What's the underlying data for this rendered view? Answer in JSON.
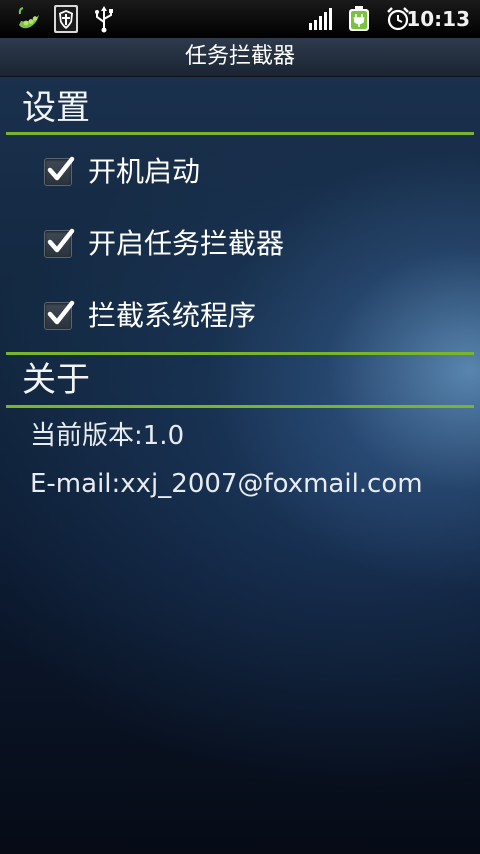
{
  "status_bar": {
    "time": "10:13",
    "icons": [
      "pea-pod-icon",
      "shield-app-icon",
      "usb-icon",
      "signal-icon",
      "battery-charging-icon",
      "alarm-clock-icon"
    ]
  },
  "app": {
    "title": "任务拦截器"
  },
  "settings_section": {
    "title": "设置",
    "items": [
      {
        "label": "开机启动",
        "checked": true
      },
      {
        "label": "开启任务拦截器",
        "checked": true
      },
      {
        "label": "拦截系统程序",
        "checked": true
      }
    ]
  },
  "about_section": {
    "title": "关于",
    "version": "当前版本:1.0",
    "email": "E-mail:xxj_2007@foxmail.com"
  },
  "colors": {
    "accent_green": "#79b52a",
    "checkmark": "#ffffff"
  }
}
